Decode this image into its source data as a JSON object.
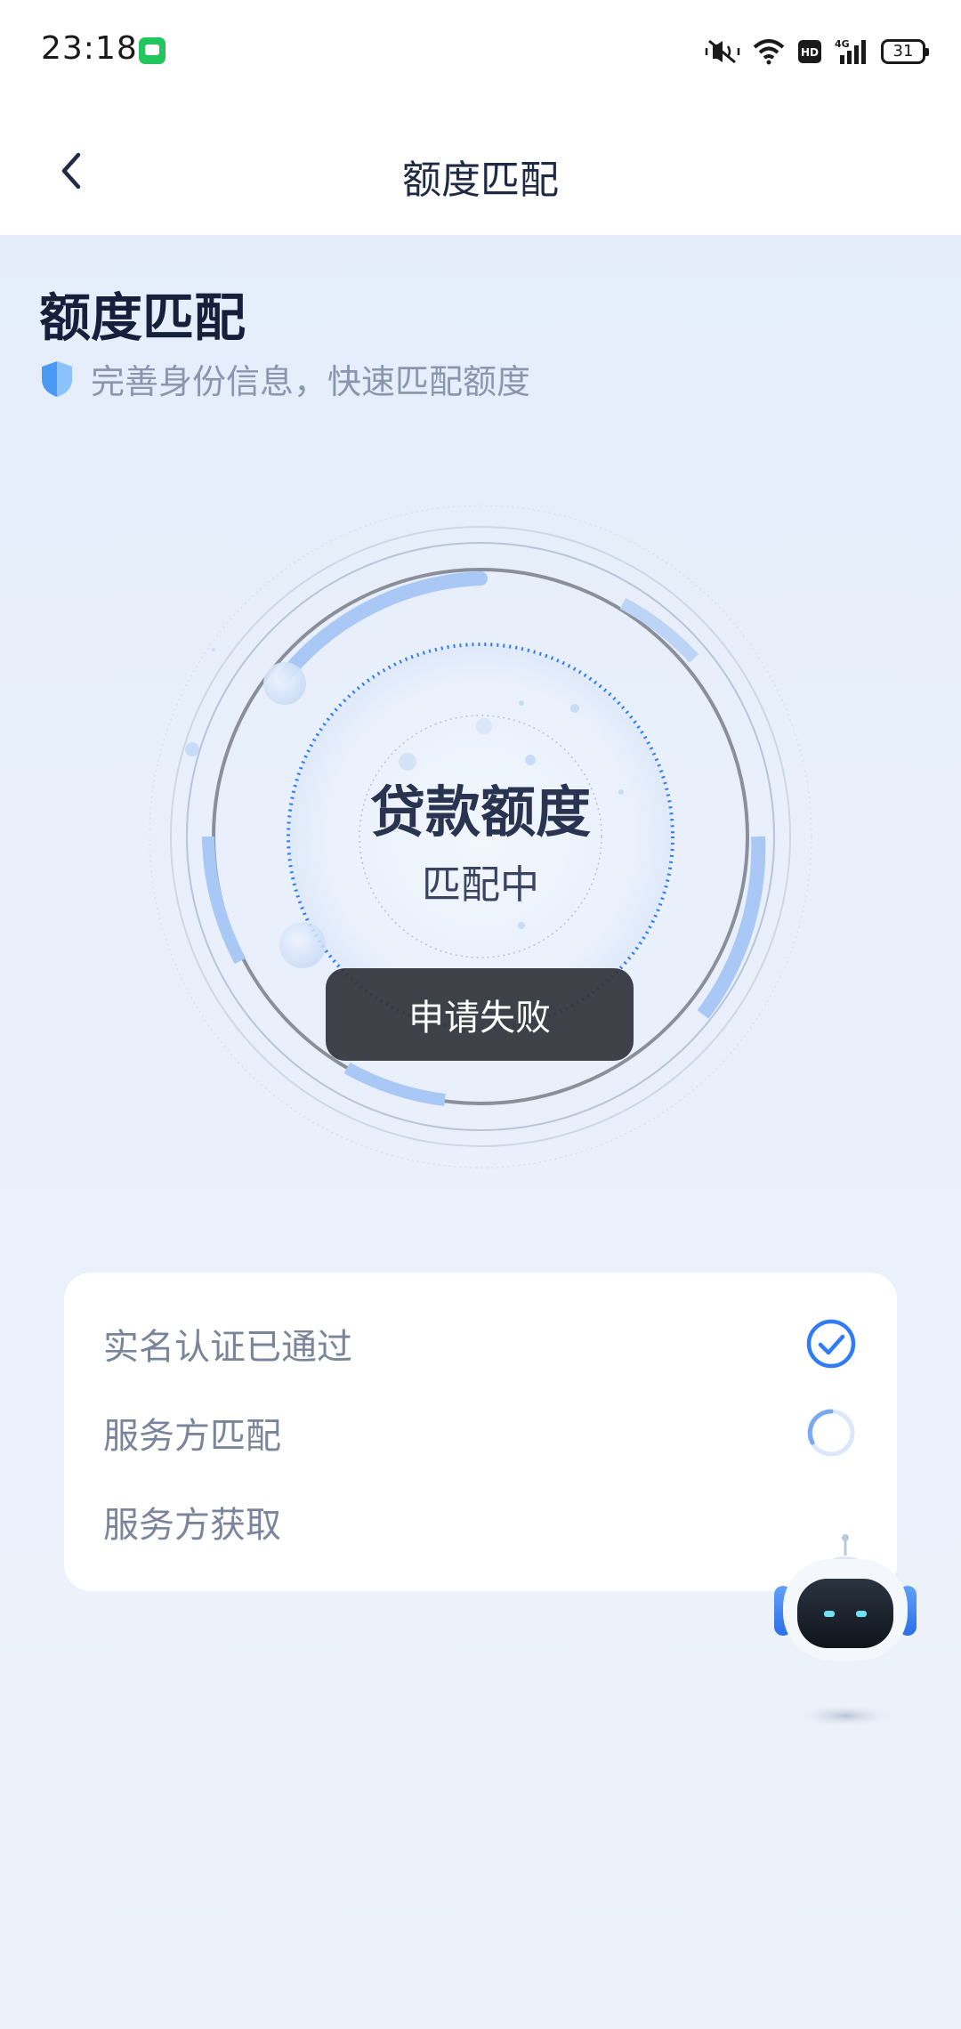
{
  "status_bar": {
    "time": "23:18",
    "icons": [
      "chat-app-icon",
      "mute-vibrate-icon",
      "wifi-icon",
      "hd-icon",
      "signal-4g-icon"
    ],
    "network_label": "4G",
    "hd_label": "HD",
    "battery_level": "31"
  },
  "header": {
    "back_icon": "chevron-left-icon",
    "title": "额度匹配"
  },
  "section": {
    "title": "额度匹配",
    "subtitle_icon": "shield-icon",
    "subtitle": "完善身份信息，快速匹配额度"
  },
  "radar": {
    "title": "贷款额度",
    "status": "匹配中"
  },
  "toast": {
    "message": "申请失败"
  },
  "steps": [
    {
      "label": "实名认证已通过",
      "state": "done",
      "icon": "check-circle-icon"
    },
    {
      "label": "服务方匹配",
      "state": "loading",
      "icon": "loading-spinner-icon"
    },
    {
      "label": "服务方获取",
      "state": "pending",
      "icon": ""
    }
  ],
  "assistant": {
    "icon": "robot-assistant-icon"
  },
  "colors": {
    "accent": "#2f7cf6",
    "background": "#e6eefb",
    "toast_bg": "#303238",
    "card_bg": "#ffffff",
    "muted_text": "#8a96ad"
  }
}
